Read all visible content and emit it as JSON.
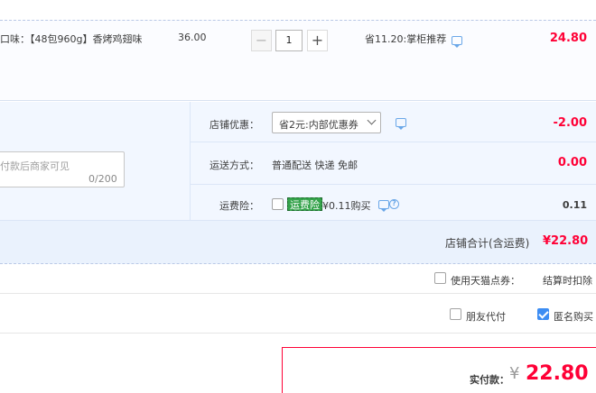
{
  "item": {
    "description": "口味：【48包960g】香烤鸡翅味",
    "unit_price": "36.00",
    "quantity": "1",
    "minus_label": "−",
    "plus_label": "+",
    "promo": "省11.20:掌柜推荐",
    "subtotal": "24.80"
  },
  "shop": {
    "message_placeholder": "付款后商家可见",
    "message_count": "0/200",
    "discount_label": "店铺优惠：",
    "discount_selected": "省2元:内部优惠券",
    "discount_amount": "-2.00",
    "shipping_label": "运送方式：",
    "shipping_value": "普通配送 快递 免邮",
    "shipping_amount": "0.00",
    "insurance_label": "运费险：",
    "insurance_badge": "运费险",
    "insurance_text": "¥0.11购买",
    "insurance_amount": "0.11",
    "shop_total_label": "店铺合计(含运费)",
    "shop_total_amount": "¥22.80"
  },
  "options": {
    "tmall_coupon_label": "使用天猫点券：",
    "tmall_coupon_note": "结算时扣除",
    "friend_pay_label": "朋友代付",
    "anonymous_label": "匿名购买",
    "anonymous_checked": true
  },
  "payment": {
    "label": "实付款：",
    "symbol": "¥",
    "amount": "22.80"
  },
  "colors": {
    "accent_red": "#ff0036",
    "link_blue": "#3d8df3",
    "insurance_green": "#35a34b"
  },
  "icons": [
    "chat-icon",
    "chevron-down-icon",
    "help-icon",
    "checkbox-icon"
  ]
}
